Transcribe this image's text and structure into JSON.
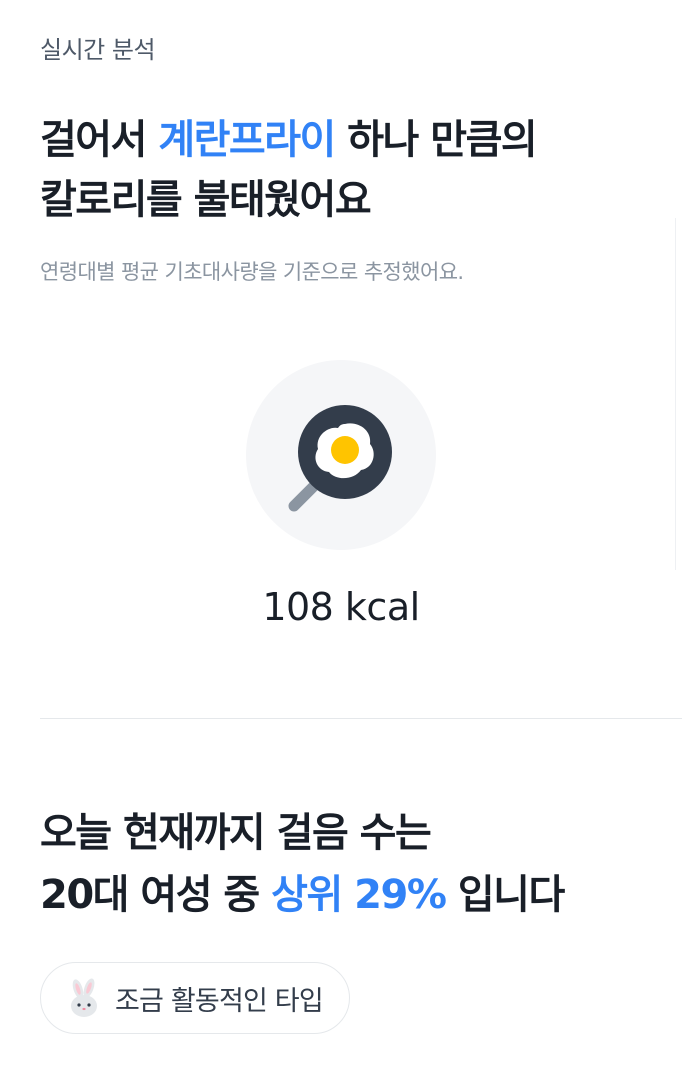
{
  "header": {
    "section_label": "실시간 분석"
  },
  "calorie_card": {
    "headline_prefix": "걸어서 ",
    "headline_accent": "계란프라이",
    "headline_suffix_line1": " 하나 만큼의",
    "headline_line2": "칼로리를 불태웠어요",
    "subnote": "연령대별 평균 기초대사량을 기준으로 추정했어요.",
    "icon": "fried-egg-pan-icon",
    "kcal_text": "108 kcal",
    "accent_color": "#3182f6"
  },
  "rank_card": {
    "line1": "오늘 현재까지 걸음 수는",
    "line2_prefix": "20대 여성 중 ",
    "line2_accent": "상위 29%",
    "line2_suffix": " 입니다",
    "chip_icon": "rabbit-icon",
    "chip_label": "조금 활동적인 타입"
  }
}
